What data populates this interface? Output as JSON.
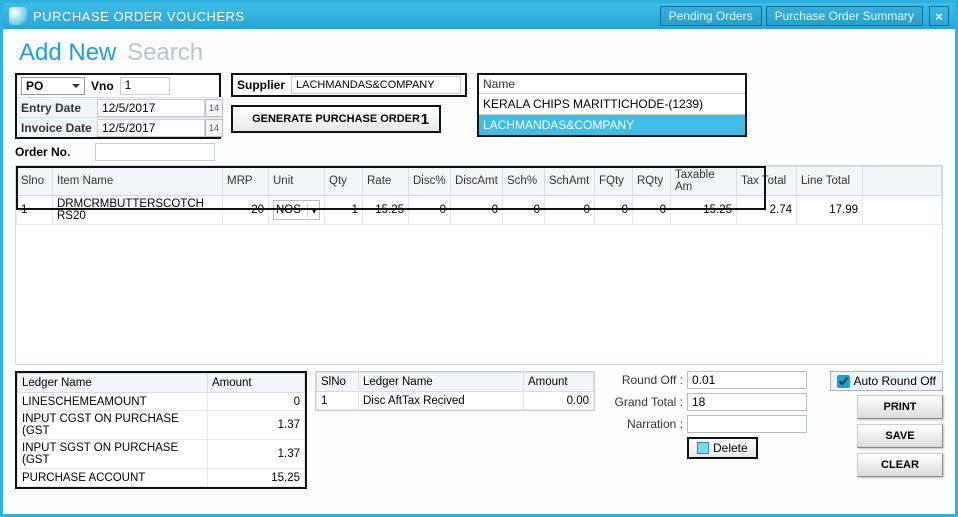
{
  "titlebar": {
    "title": "PURCHASE ORDER VOUCHERS",
    "pending_link": "Pending Orders",
    "summary_link": "Purchase Order Summary",
    "close": "×"
  },
  "tabs": {
    "add_new": "Add New",
    "search": "Search"
  },
  "top": {
    "po_type": "PO",
    "vno_label": "Vno",
    "vno_value": "1",
    "entry_date_label": "Entry Date",
    "entry_date_value": "12/5/2017",
    "invoice_date_label": "Invoice Date",
    "invoice_date_value": "12/5/2017",
    "cal_text": "14",
    "order_no_label": "Order No.",
    "order_no_value": "",
    "supplier_label": "Supplier",
    "supplier_value": "LACHMANDAS&COMPANY",
    "gen_btn": "GENERATE PURCHASE ORDER",
    "gen_btn_num": "1"
  },
  "name_box": {
    "header": "Name",
    "item1": "KERALA CHIPS MARITTICHODE-(1239)",
    "item2": "LACHMANDAS&COMPANY"
  },
  "grid": {
    "headers": {
      "slno": "Slno",
      "item": "Item Name",
      "mrp": "MRP",
      "unit": "Unit",
      "qty": "Qty",
      "rate": "Rate",
      "discp": "Disc%",
      "discamt": "DiscAmt",
      "schp": "Sch%",
      "schamt": "SchAmt",
      "fqty": "FQty",
      "rqty": "RQty",
      "taxable": "Taxable Am",
      "taxtotal": "Tax Total",
      "linetotal": "Line Total"
    },
    "row1": {
      "slno": "1",
      "item": "DRMCRMBUTTERSCOTCH RS20",
      "mrp": "20",
      "unit": "NOS",
      "qty": "1",
      "rate": "15.25",
      "discp": "0",
      "discamt": "0",
      "schp": "0",
      "schamt": "0",
      "fqty": "0",
      "rqty": "0",
      "taxable": "15.25",
      "taxtotal": "2.74",
      "linetotal": "17.99"
    }
  },
  "ledger": {
    "h1": "Ledger Name",
    "h2": "Amount",
    "r1n": "LINESCHEMEAMOUNT",
    "r1a": "0",
    "r2n": "INPUT CGST ON PURCHASE (GST",
    "r2a": "1.37",
    "r3n": "INPUT SGST ON PURCHASE (GST",
    "r3a": "1.37",
    "r4n": "PURCHASE ACCOUNT",
    "r4a": "15.25"
  },
  "mid": {
    "h1": "SlNo",
    "h2": "Ledger Name",
    "h3": "Amount",
    "r1s": "1",
    "r1n": "Disc AftTax Recived",
    "r1a": "0.00"
  },
  "totals": {
    "roundoff_label": "Round Off :",
    "roundoff_value": "0.01",
    "grand_label": "Grand Total :",
    "grand_value": "18",
    "narration_label": "Narration :",
    "delete_btn": "Delete"
  },
  "right": {
    "auto_round": "Auto Round Off",
    "print": "PRINT",
    "save": "SAVE",
    "clear": "CLEAR"
  }
}
